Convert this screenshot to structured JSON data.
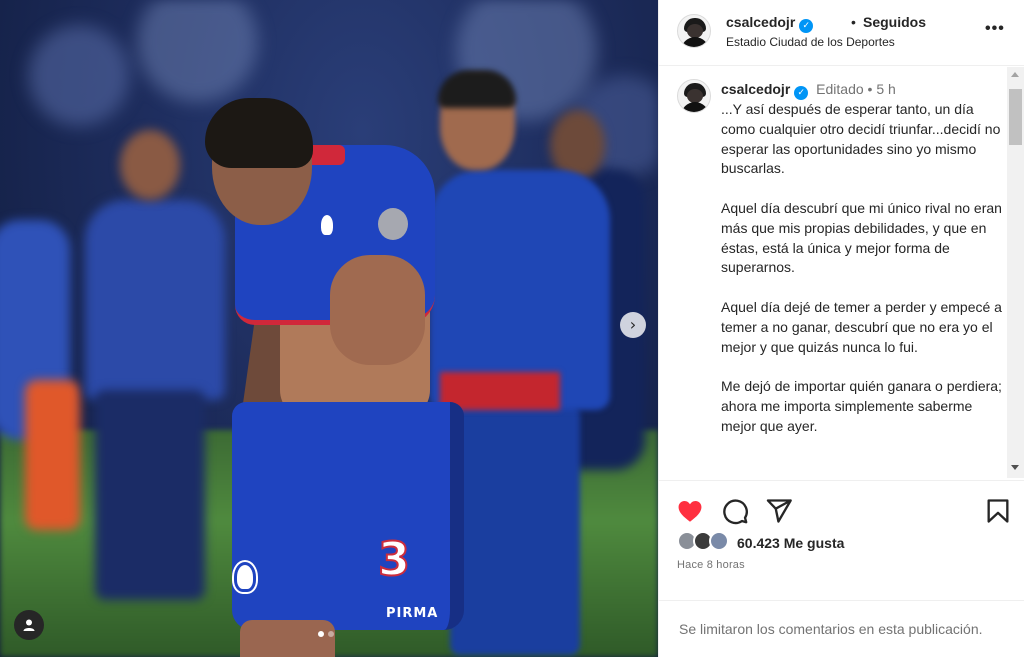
{
  "post": {
    "username": "csalcedojr",
    "follow_status": "Seguidos",
    "location": "Estadio Ciudad de los Deportes",
    "more_options_icon": "more-horizontal-icon"
  },
  "media": {
    "jersey_number": "3",
    "brand_text": "PIRMA",
    "carousel_dots": 2,
    "active_dot": 0,
    "next_icon": "chevron-right-icon",
    "tag_icon": "user-tag-icon"
  },
  "caption": {
    "username": "csalcedojr",
    "edited_label": "Editado",
    "separator": "•",
    "time": "5 h",
    "paragraphs": [
      "...Y así después de esperar tanto, un día como cualquier otro decidí triunfar...decidí no esperar las oportunidades sino yo mismo buscarlas.",
      "Aquel día descubrí que mi único rival no eran más que mis propias debilidades, y que en éstas, está la única y mejor forma de superarnos.",
      "Aquel día dejé de temer a perder y empecé a temer a no ganar, descubrí que no era yo el mejor y que quizás nunca lo fui.",
      "Me dejó de importar quién ganara o perdiera; ahora me importa simplemente saberme mejor que ayer."
    ]
  },
  "actions": {
    "like_icon": "heart-filled-icon",
    "comment_icon": "comment-icon",
    "share_icon": "send-icon",
    "save_icon": "bookmark-icon",
    "like_color": "#ff3040"
  },
  "likes": {
    "count_text": "60.423 Me gusta",
    "posted_ago": "Hace 8 horas"
  },
  "comments": {
    "limited_text": "Se limitaron los comentarios en esta publicación."
  },
  "colors": {
    "verified": "#0095f6",
    "secondary_text": "#737373",
    "primary_text": "#262626",
    "divider": "#efefef"
  }
}
